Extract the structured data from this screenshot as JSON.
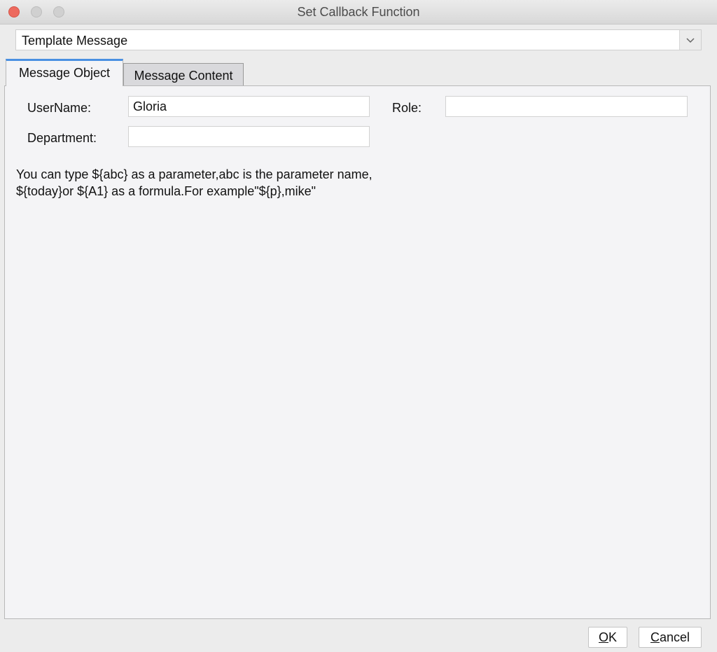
{
  "window": {
    "title": "Set Callback Function"
  },
  "template_select": {
    "value": "Template Message",
    "arrow_icon": "chevron-down-icon"
  },
  "tabs": [
    {
      "label": "Message Object",
      "active": true
    },
    {
      "label": "Message Content",
      "active": false
    }
  ],
  "form": {
    "username": {
      "label": "UserName:",
      "value": "Gloria"
    },
    "role": {
      "label": "Role:",
      "value": ""
    },
    "department": {
      "label": "Department:",
      "value": ""
    }
  },
  "hint": {
    "line1": "You can type ${abc} as a parameter,abc is the parameter name,",
    "line2": "${today}or ${A1} as a formula.For example\"${p},mike\""
  },
  "buttons": {
    "ok": {
      "mnemonic": "O",
      "rest": "K"
    },
    "cancel": {
      "mnemonic": "C",
      "rest": "ancel"
    }
  },
  "colors": {
    "active_tab_accent": "#4a90e2",
    "close_button": "#ed6a5e"
  }
}
